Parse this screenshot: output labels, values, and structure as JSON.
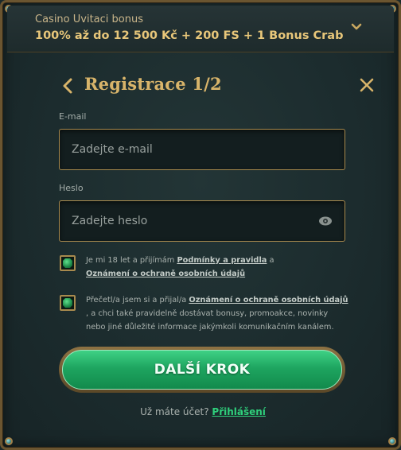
{
  "bonus": {
    "title": "Casino Uvitaci bonus",
    "offer": "100% až do 12 500 Kč + 200 FS + 1 Bonus Crab"
  },
  "registration": {
    "title": "Registrace 1/2"
  },
  "email": {
    "label": "E-mail",
    "placeholder": "Zadejte e-mail"
  },
  "password": {
    "label": "Heslo",
    "placeholder": "Zadejte heslo"
  },
  "consents": [
    {
      "text_before": "Je mi 18 let a přijímám ",
      "link1": "Podmínky a pravidla",
      "text_middle": " a ",
      "link2": "Oznámení o ochraně osobních údajů",
      "checked": true
    },
    {
      "text_before": "Přečetl/a jsem si a přijal/a ",
      "link1": "Oznámení o ochraně osobních údajů",
      "text_after": " , a chci také pravidelně dostávat bonusy, promoakce, novinky nebo jiné důležité informace jakýmkoli komunikačním kanálem.",
      "checked": true
    }
  ],
  "cta": {
    "label": "DALŠÍ KROK"
  },
  "login": {
    "prompt": "Už máte účet?",
    "link": "Přihlášení"
  },
  "colors": {
    "accent_gold": "#d8b46a",
    "cta_green": "#1ea560",
    "link_green": "#2fd07c"
  },
  "icons": {
    "header_toggle": "chevron-down-icon",
    "back": "chevron-left-icon",
    "close": "close-icon",
    "password_visibility": "eye-icon",
    "checkbox_mark": "green-gem-icon"
  }
}
